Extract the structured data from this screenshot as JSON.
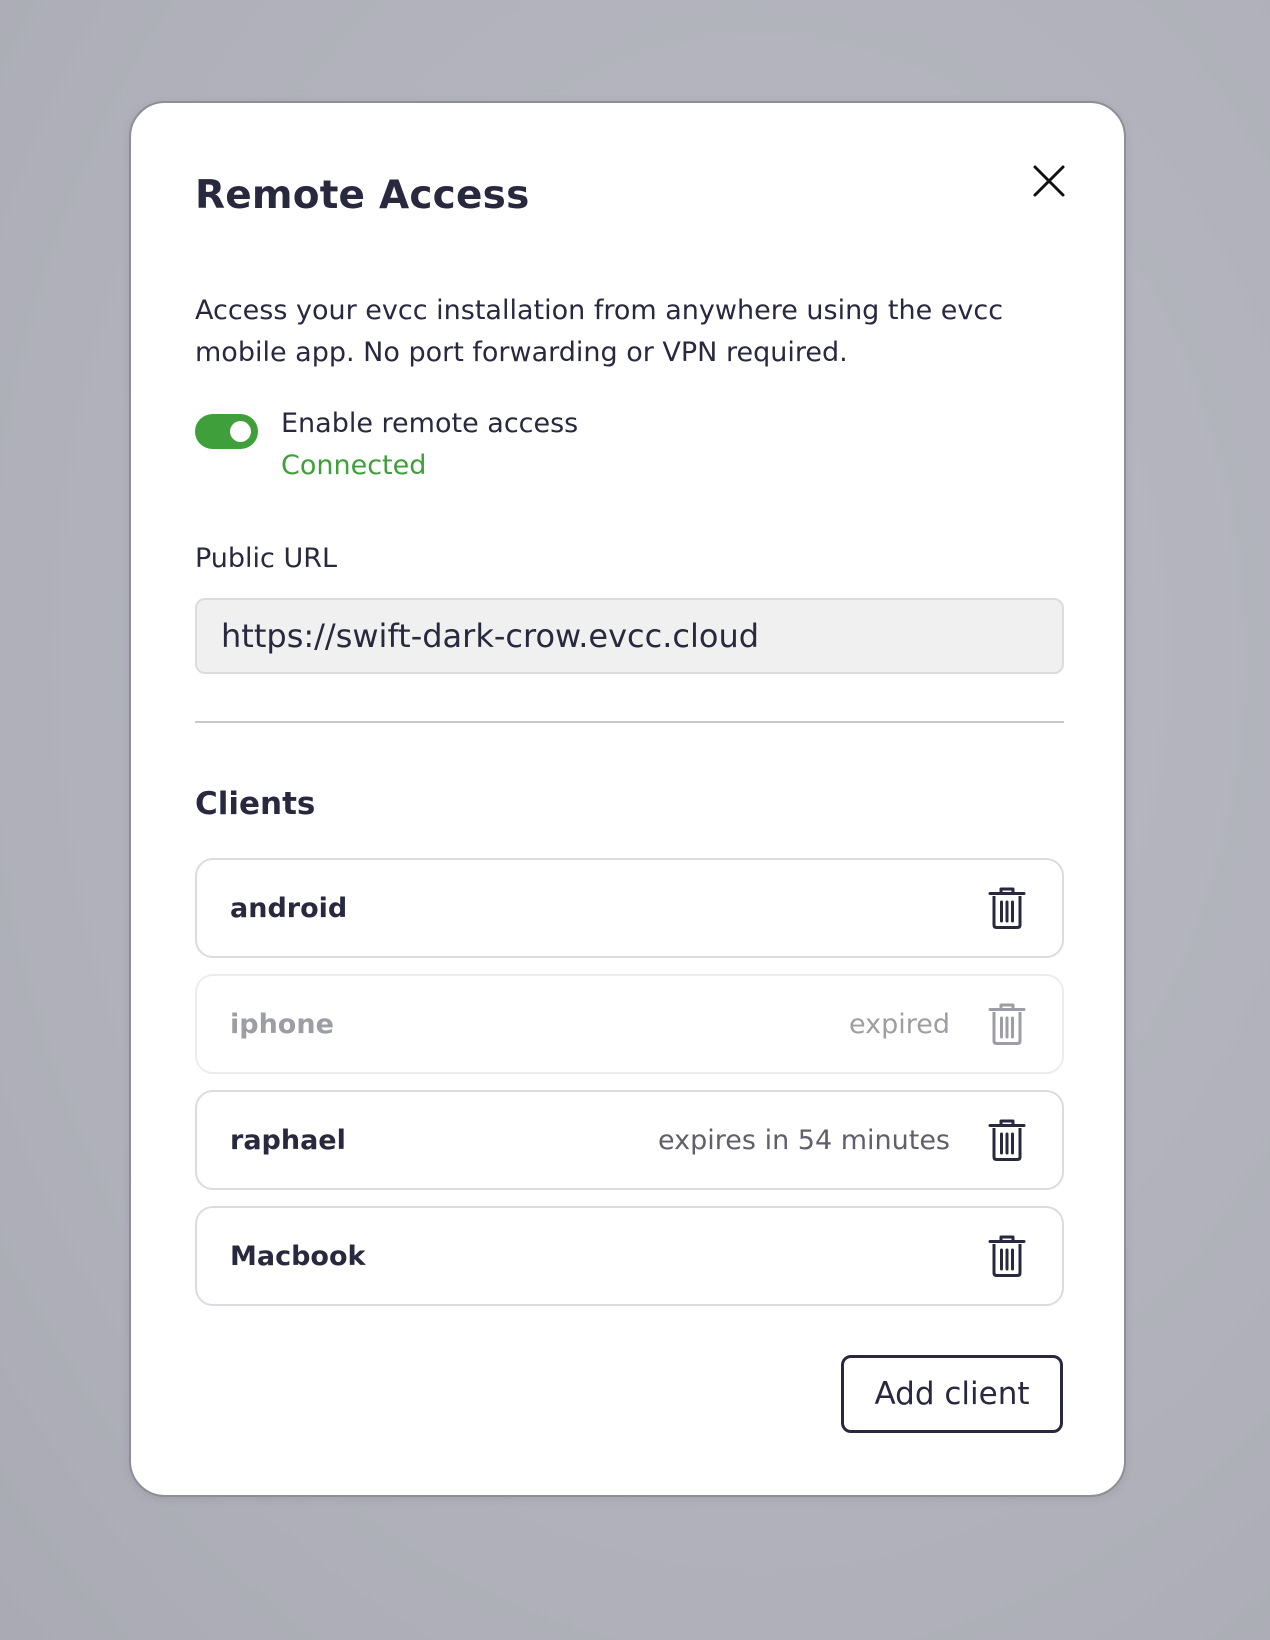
{
  "modal": {
    "title": "Remote Access",
    "description": "Access your evcc installation from anywhere using the evcc mobile app. No port forwarding or VPN required.",
    "close_icon": "close-icon"
  },
  "remote_access": {
    "enabled": true,
    "toggle_label": "Enable remote access",
    "status": "Connected",
    "status_color": "#3f9f3b"
  },
  "public_url": {
    "label": "Public URL",
    "value": "https://swift-dark-crow.evcc.cloud"
  },
  "clients": {
    "heading": "Clients",
    "items": [
      {
        "name": "android",
        "expiry": "",
        "expired": false,
        "delete_icon": "trash-icon"
      },
      {
        "name": "iphone",
        "expiry": "expired",
        "expired": true,
        "delete_icon": "trash-icon"
      },
      {
        "name": "raphael",
        "expiry": "expires in 54 minutes",
        "expired": false,
        "delete_icon": "trash-icon"
      },
      {
        "name": "Macbook",
        "expiry": "",
        "expired": false,
        "delete_icon": "trash-icon"
      }
    ],
    "add_button_label": "Add client"
  },
  "colors": {
    "accent_green": "#3f9f3b",
    "text_dark": "#28293e",
    "text_muted": "#9d9da6"
  }
}
